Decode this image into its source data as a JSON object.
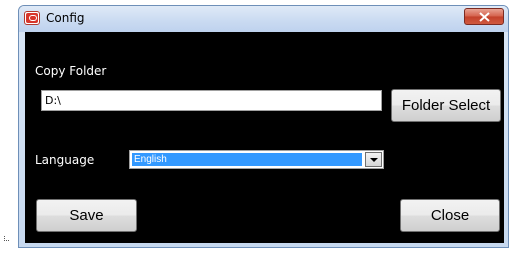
{
  "window": {
    "title": "Config",
    "icon": "app-icon",
    "close_icon": "close-icon",
    "close_button_color": "#d05a40"
  },
  "form": {
    "copy_folder_label": "Copy Folder",
    "copy_folder_value": "D:\\",
    "folder_select_label": "Folder Select",
    "language_label": "Language",
    "language_selected": "English",
    "language_dropdown_icon": "chevron-down-icon",
    "selection_color": "#3399ff"
  },
  "actions": {
    "save_label": "Save",
    "close_label": "Close"
  }
}
